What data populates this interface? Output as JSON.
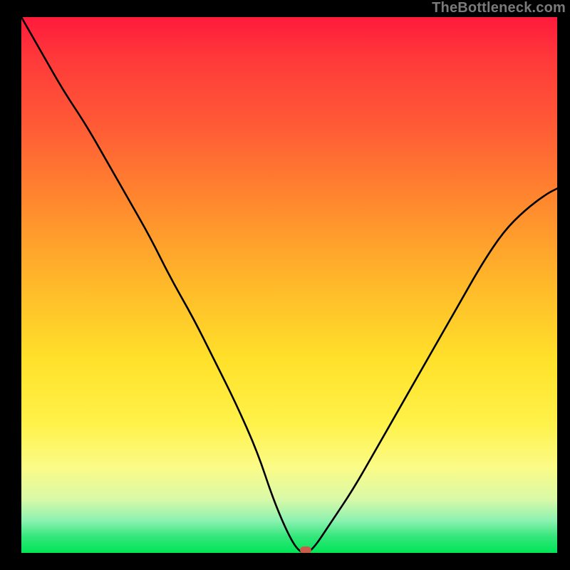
{
  "watermark": "TheBottleneck.com",
  "colors": {
    "black": "#000000",
    "curve": "#000000",
    "marker": "#cc5a4a",
    "gradient_top": "#ff1a3c",
    "gradient_bottom": "#00e556"
  },
  "chart_data": {
    "type": "line",
    "title": "",
    "xlabel": "",
    "ylabel": "",
    "xlim": [
      0,
      100
    ],
    "ylim": [
      0,
      100
    ],
    "grid": false,
    "legend": false,
    "annotations": [
      {
        "text": "TheBottleneck.com",
        "position": "top-right"
      }
    ],
    "series": [
      {
        "name": "bottleneck-curve",
        "x": [
          0,
          4,
          8,
          12,
          16,
          20,
          24,
          28,
          32,
          36,
          40,
          44,
          47,
          50,
          52,
          54,
          58,
          62,
          66,
          70,
          74,
          78,
          82,
          86,
          90,
          94,
          98,
          100
        ],
        "y": [
          100,
          93,
          86,
          80,
          73,
          66,
          59,
          51,
          44,
          36,
          28,
          19,
          10,
          3,
          0,
          0,
          6,
          12,
          19,
          26,
          33,
          40,
          47,
          54,
          60,
          64,
          67,
          68
        ]
      }
    ],
    "marker": {
      "x": 53,
      "y": 0,
      "color": "#cc5a4a"
    },
    "background_gradient": {
      "direction": "vertical",
      "stops": [
        {
          "pos": 0.0,
          "color": "#ff1a3c"
        },
        {
          "pos": 0.5,
          "color": "#ffb92a"
        },
        {
          "pos": 0.84,
          "color": "#fbfb87"
        },
        {
          "pos": 1.0,
          "color": "#00e556"
        }
      ]
    }
  }
}
